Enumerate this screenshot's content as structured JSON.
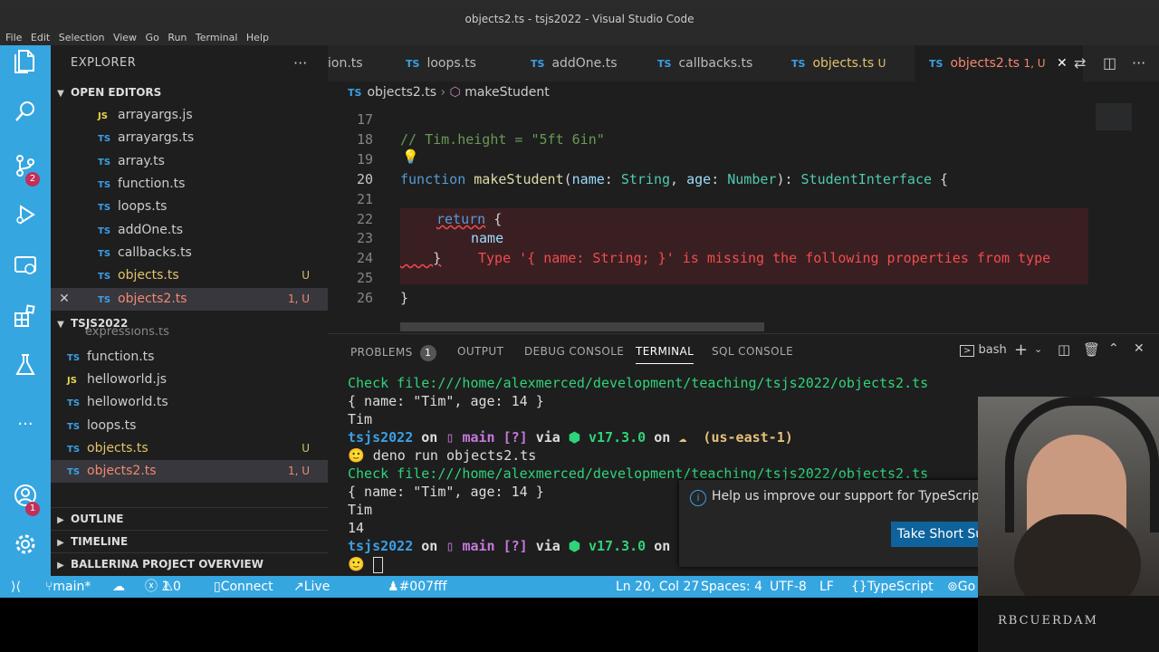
{
  "window": {
    "title": "objects2.ts - tsjs2022 - Visual Studio Code"
  },
  "menu": [
    "File",
    "Edit",
    "Selection",
    "View",
    "Go",
    "Run",
    "Terminal",
    "Help"
  ],
  "activity_bar": {
    "source_control_badge": "2",
    "accounts_badge": "1",
    "more": "..."
  },
  "sidebar": {
    "title": "EXPLORER",
    "more": "···",
    "open_editors": {
      "label": "OPEN EDITORS",
      "files": [
        {
          "icon": "JS",
          "name": "arrayargs.js",
          "tag": ""
        },
        {
          "icon": "TS",
          "name": "arrayargs.ts",
          "tag": ""
        },
        {
          "icon": "TS",
          "name": "array.ts",
          "tag": ""
        },
        {
          "icon": "TS",
          "name": "function.ts",
          "tag": ""
        },
        {
          "icon": "TS",
          "name": "loops.ts",
          "tag": ""
        },
        {
          "icon": "TS",
          "name": "addOne.ts",
          "tag": ""
        },
        {
          "icon": "TS",
          "name": "callbacks.ts",
          "tag": ""
        },
        {
          "icon": "TS",
          "name": "objects.ts",
          "tag": "U"
        },
        {
          "icon": "TS",
          "name": "objects2.ts",
          "tag": "1, U"
        }
      ]
    },
    "project": {
      "label": "TSJS2022",
      "partial": "expressions.ts",
      "files": [
        {
          "icon": "TS",
          "name": "function.ts",
          "tag": ""
        },
        {
          "icon": "JS",
          "name": "helloworld.js",
          "tag": ""
        },
        {
          "icon": "TS",
          "name": "helloworld.ts",
          "tag": ""
        },
        {
          "icon": "TS",
          "name": "loops.ts",
          "tag": ""
        },
        {
          "icon": "TS",
          "name": "objects.ts",
          "tag": "U"
        },
        {
          "icon": "TS",
          "name": "objects2.ts",
          "tag": "1, U"
        }
      ]
    },
    "outline": "OUTLINE",
    "timeline": "TIMELINE",
    "ballerina": "BALLERINA PROJECT OVERVIEW"
  },
  "tabs": [
    {
      "icon": "",
      "label": "ion.ts",
      "tag": ""
    },
    {
      "icon": "TS",
      "label": "loops.ts",
      "tag": ""
    },
    {
      "icon": "TS",
      "label": "addOne.ts",
      "tag": ""
    },
    {
      "icon": "TS",
      "label": "callbacks.ts",
      "tag": ""
    },
    {
      "icon": "TS",
      "label": "objects.ts",
      "tag": "U"
    },
    {
      "icon": "TS",
      "label": "objects2.ts",
      "tag": "1, U"
    }
  ],
  "breadcrumb": {
    "icon": "TS",
    "file": "objects2.ts",
    "symbol": "makeStudent"
  },
  "editor": {
    "lines": [
      "17",
      "18",
      "19",
      "20",
      "21",
      "22",
      "23",
      "24",
      "25",
      "26"
    ],
    "line18": "// Tim.height = \"5ft 6in\"",
    "l20_kw": "function",
    "l20_fn": "makeStudent",
    "l20_p1": "name",
    "l20_t1": "String",
    "l20_p2": "age",
    "l20_t2": "Number",
    "l20_ret": "StudentInterface",
    "l22_kw": "return",
    "l23_name": "name",
    "error_msg": "Type '{ name: String; }' is missing the following properties from type"
  },
  "panel": {
    "tabs": [
      "PROBLEMS",
      "OUTPUT",
      "DEBUG CONSOLE",
      "TERMINAL",
      "SQL CONSOLE"
    ],
    "problems_count": "1",
    "shell": "bash",
    "terminal": {
      "check1": "Check file:///home/alexmerced/development/teaching/tsjs2022/objects2.ts",
      "obj1": "{ name: \"Tim\", age: 14 }",
      "tim1": "Tim",
      "prompt_dir": "tsjs2022",
      "on": "on",
      "branch": "main",
      "status": "[?]",
      "via": "via",
      "node": "v17.3.0",
      "aws": "(us-east-1)",
      "cmd": "deno run objects2.ts",
      "check2": "Check file:///home/alexmerced/development/teaching/tsjs2022/objects2.ts",
      "obj2": "{ name: \"Tim\", age: 14 }",
      "tim2": "Tim",
      "age": "14"
    }
  },
  "notification": {
    "message": "Help us improve our support for TypeScript",
    "button": "Take Short Survey"
  },
  "statusbar": {
    "branch": "main*",
    "errors": "1",
    "warnings": "0",
    "connect": "Connect",
    "live_share": "Live Share",
    "color": "#007fff",
    "position": "Ln 20, Col 27",
    "spaces": "Spaces: 4",
    "encoding": "UTF-8",
    "eol": "LF",
    "language": "TypeScript",
    "go": "Go"
  },
  "webcam": {
    "shirt_text": "RBCUERDAM"
  }
}
